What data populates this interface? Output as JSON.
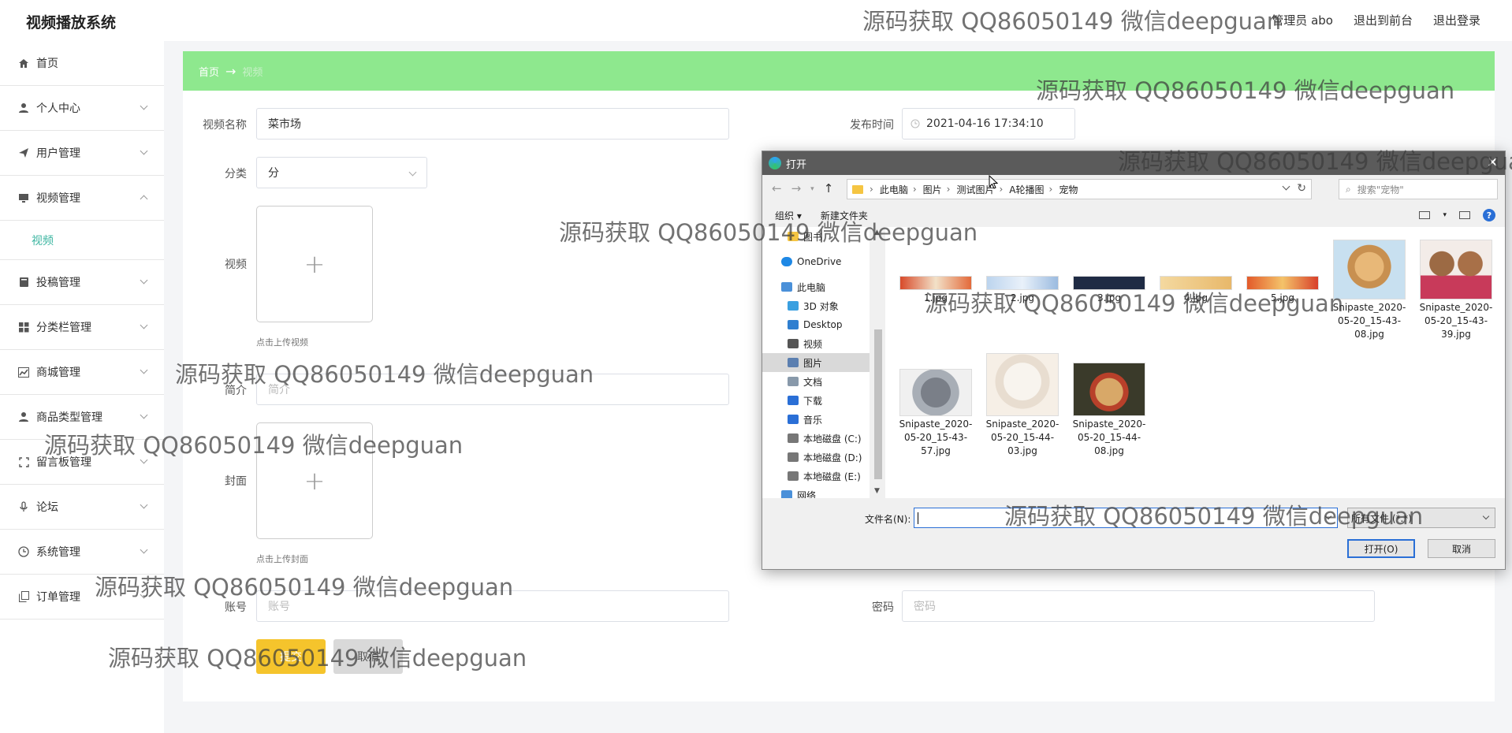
{
  "header": {
    "title": "视频播放系统",
    "admin": "管理员 abo",
    "front": "退出到前台",
    "logout": "退出登录"
  },
  "sidebar": {
    "items": [
      {
        "label": "首页",
        "icon": "home-icon"
      },
      {
        "label": "个人中心",
        "icon": "user-icon"
      },
      {
        "label": "用户管理",
        "icon": "send-icon"
      },
      {
        "label": "视频管理",
        "icon": "monitor-icon"
      },
      {
        "label": "投稿管理",
        "icon": "book-icon"
      },
      {
        "label": "分类栏管理",
        "icon": "grid-icon"
      },
      {
        "label": "商城管理",
        "icon": "chart-icon"
      },
      {
        "label": "商品类型管理",
        "icon": "user-icon"
      },
      {
        "label": "留言板管理",
        "icon": "expand-icon"
      },
      {
        "label": "论坛",
        "icon": "mic-icon"
      },
      {
        "label": "系统管理",
        "icon": "clock-icon"
      },
      {
        "label": "订单管理",
        "icon": "copy-icon"
      }
    ],
    "sub_item": "视频"
  },
  "breadcrumb": {
    "home": "首页",
    "arrow": "→",
    "current": "视频"
  },
  "form": {
    "name_label": "视频名称",
    "name_value": "菜市场",
    "time_label": "发布时间",
    "time_value": "2021-04-16 17:34:10",
    "category_label": "分类",
    "category_value": "分",
    "video_label": "视频",
    "video_hint": "点击上传视频",
    "intro_label": "简介",
    "intro_placeholder": "简介",
    "cover_label": "封面",
    "cover_hint": "点击上传封面",
    "account_label": "账号",
    "account_placeholder": "账号",
    "password_label": "密码",
    "password_placeholder": "密码",
    "submit_label": "提交",
    "cancel_label": "取消",
    "plus": "+"
  },
  "dialog": {
    "title": "打开",
    "close": "✕",
    "path": [
      "此电脑",
      "图片",
      "测试图片",
      "A轮播图",
      "宠物"
    ],
    "search_placeholder": "搜索\"宠物\"",
    "organize": "组织 ▾",
    "new_folder": "新建文件夹",
    "help": "?",
    "tree": [
      {
        "label": "图书",
        "color": "#f5c542"
      },
      {
        "label": "OneDrive",
        "color": "#1e88e5"
      },
      {
        "label": "此电脑",
        "color": "#4a90d9"
      },
      {
        "label": "3D 对象",
        "color": "#3aa0e0"
      },
      {
        "label": "Desktop",
        "color": "#2f7fd0"
      },
      {
        "label": "视频",
        "color": "#555555"
      },
      {
        "label": "图片",
        "color": "#5b7fb0"
      },
      {
        "label": "文档",
        "color": "#8899aa"
      },
      {
        "label": "下载",
        "color": "#2a6fd6"
      },
      {
        "label": "音乐",
        "color": "#2a6fd6"
      },
      {
        "label": "本地磁盘 (C:)",
        "color": "#777777"
      },
      {
        "label": "本地磁盘 (D:)",
        "color": "#777777"
      },
      {
        "label": "本地磁盘 (E:)",
        "color": "#777777"
      },
      {
        "label": "网络",
        "color": "#4a90d9"
      }
    ],
    "files": [
      {
        "name": "1.jpg"
      },
      {
        "name": "2.jpg"
      },
      {
        "name": "3.jpg"
      },
      {
        "name": "4.jpg"
      },
      {
        "name": "5.jpg"
      },
      {
        "name": "Snipaste_2020-05-20_15-43-08.jpg"
      },
      {
        "name": "Snipaste_2020-05-20_15-43-39.jpg"
      },
      {
        "name": "Snipaste_2020-05-20_15-43-57.jpg"
      },
      {
        "name": "Snipaste_2020-05-20_15-44-03.jpg"
      },
      {
        "name": "Snipaste_2020-05-20_15-44-08.jpg"
      }
    ],
    "filename_label": "文件名(N):",
    "filetype": "所有文件 (*.*)",
    "open_label": "打开(O)",
    "cancel_label": "取消"
  },
  "watermark": "源码获取 QQ86050149 微信deepguan"
}
